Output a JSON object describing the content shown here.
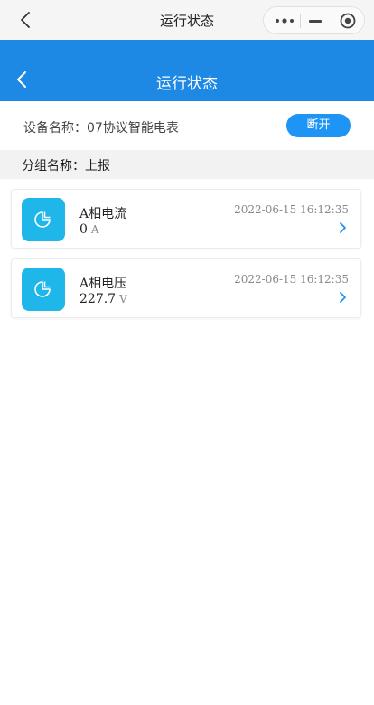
{
  "topbar": {
    "title": "运行状态"
  },
  "header": {
    "title": "运行状态"
  },
  "device": {
    "label": "设备名称：07协议智能电表",
    "button": "断开"
  },
  "group": {
    "label": "分组名称：上报"
  },
  "items": [
    {
      "name": "A相电流",
      "value": "0",
      "unit": "A",
      "time": "2022-06-15 16:12:35"
    },
    {
      "name": "A相电压",
      "value": "227.7",
      "unit": "V",
      "time": "2022-06-15 16:12:35"
    }
  ],
  "colors": {
    "header": "#1e88e5",
    "button": "#1e95f5",
    "icon_tile": "#1fb7ea"
  },
  "icons": [
    "back-icon",
    "more-icon",
    "minimize-icon",
    "close-target-icon",
    "chart-pie-icon",
    "chevron-right-icon"
  ]
}
